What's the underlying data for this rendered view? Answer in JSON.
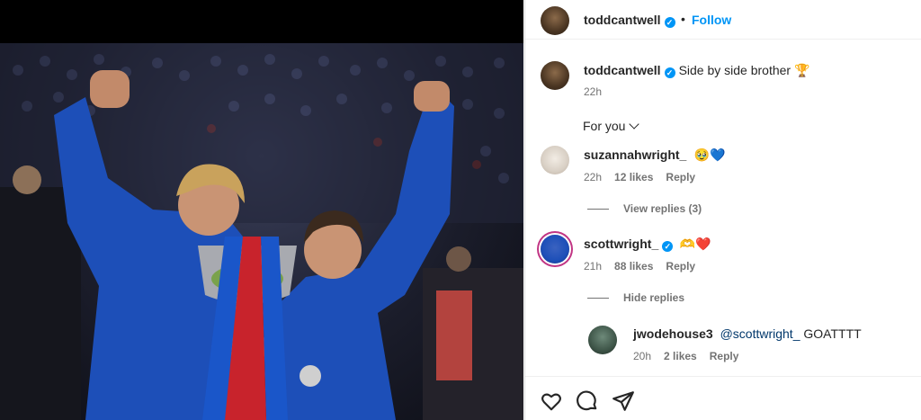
{
  "post": {
    "author": "toddcantwell",
    "follow_label": "Follow",
    "caption_text": "Side by side brother 🏆",
    "caption_time": "22h",
    "for_you_label": "For you"
  },
  "comments": [
    {
      "user": "suzannahwright_",
      "text": "🥹💙",
      "time": "22h",
      "likes": "12 likes",
      "reply_label": "Reply",
      "view_replies": "View replies (3)"
    },
    {
      "user": "scottwright_",
      "text": "🫶❤️",
      "time": "21h",
      "likes": "88 likes",
      "reply_label": "Reply",
      "hide_replies": "Hide replies",
      "reply": {
        "user": "jwodehouse3",
        "mention": "@scottwright_",
        "text": "GOATTTT",
        "time": "20h",
        "likes": "2 likes",
        "reply_label": "Reply"
      }
    }
  ],
  "icons": {
    "verified": "verified-badge-icon",
    "like": "heart-icon",
    "comment": "comment-icon",
    "share": "send-icon"
  },
  "colors": {
    "link_blue": "#0095f6",
    "kit_blue": "#1d4fb8",
    "muted": "#737373"
  }
}
